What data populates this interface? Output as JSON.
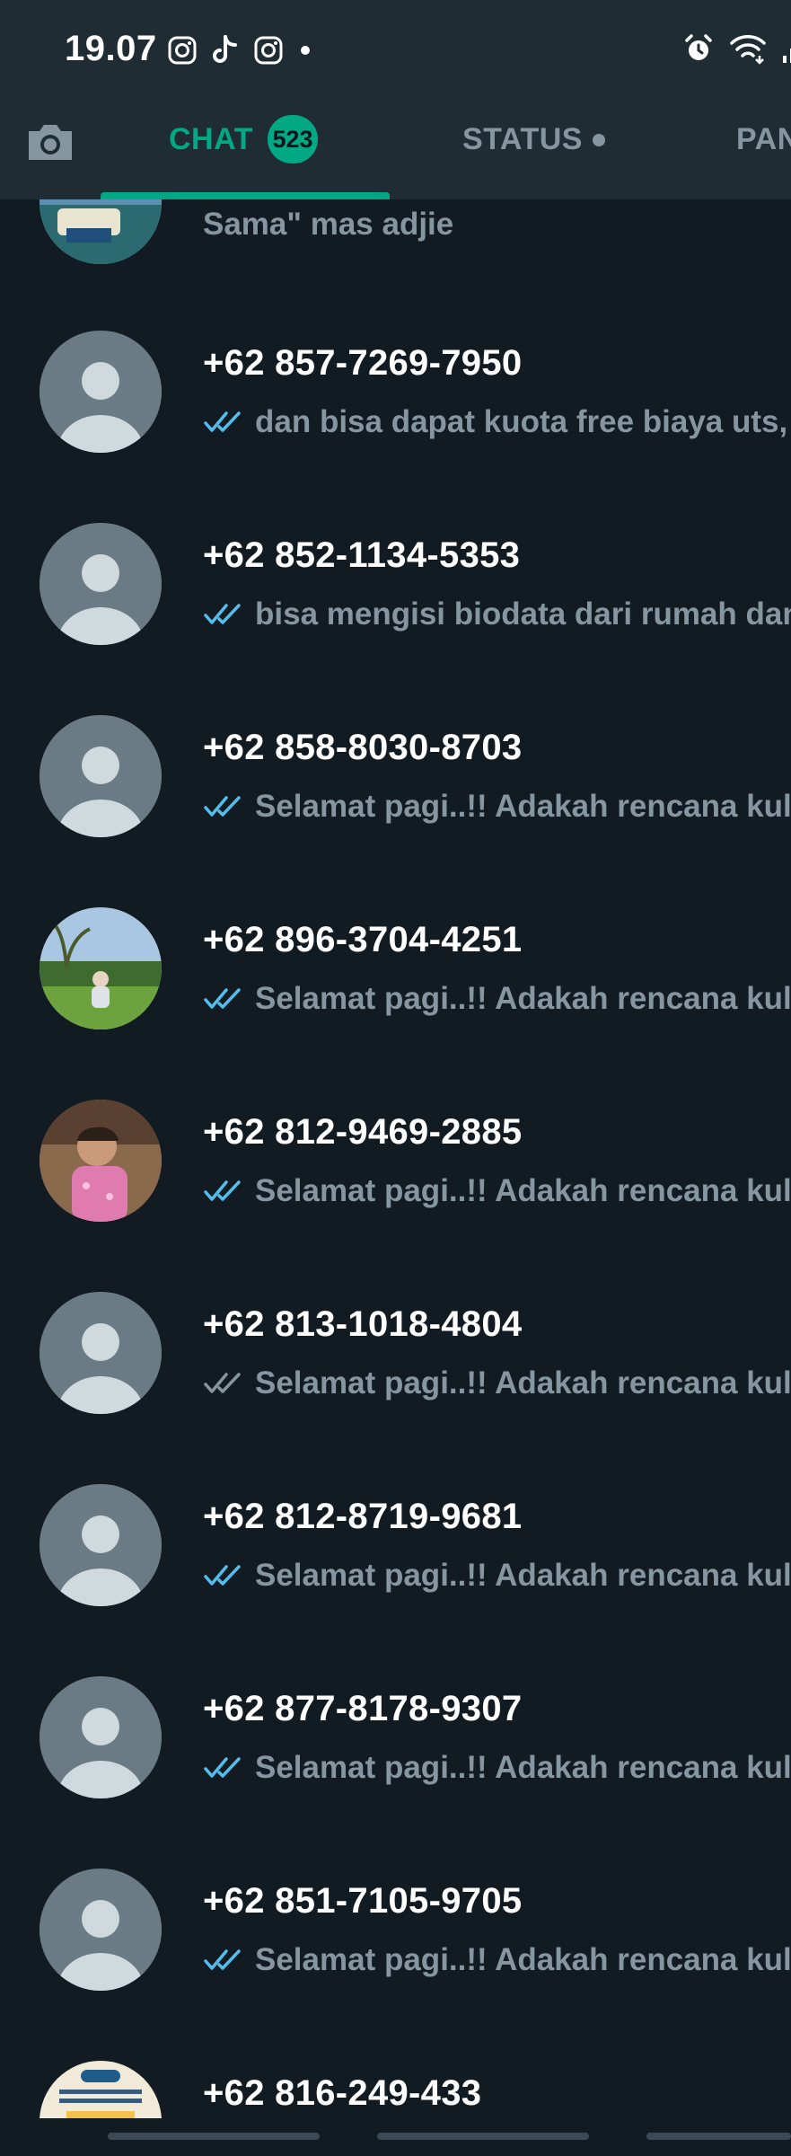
{
  "statusbar": {
    "time": "19.07",
    "left_icons": [
      "instagram-icon",
      "tiktok-icon",
      "instagram-icon",
      "notification-dot-icon"
    ],
    "right_icons": [
      "alarm-icon",
      "wifi-icon",
      "signal-icon"
    ]
  },
  "tabs": {
    "camera_icon": "camera-icon",
    "chat_label": "CHAT",
    "chat_badge": "523",
    "status_label": "STATUS",
    "calls_label": "PANGGILAN",
    "active": "CHAT"
  },
  "colors": {
    "accent": "#00a884",
    "background": "#121b22",
    "header": "#1f2c34",
    "read_tick": "#53bdeb",
    "delivered_tick": "#8696a0"
  },
  "partial_chat": {
    "preview": "Sama\" mas adjie"
  },
  "chats": [
    {
      "name": "+62 857-7269-7950",
      "preview": "dan bisa dapat kuota free biaya uts, uas",
      "tick": "read",
      "avatar": "default"
    },
    {
      "name": "+62 852-1134-5353",
      "preview": "bisa mengisi biodata dari rumah dan",
      "tick": "read",
      "avatar": "default"
    },
    {
      "name": "+62 858-8030-8703",
      "preview": "Selamat pagi..!! Adakah rencana kuliah",
      "tick": "read",
      "avatar": "default"
    },
    {
      "name": "+62 896-3704-4251",
      "preview": "Selamat pagi..!! Adakah rencana kuliah",
      "tick": "read",
      "avatar": "photo-park"
    },
    {
      "name": "+62 812-9469-2885",
      "preview": "Selamat pagi..!! Adakah rencana kuliah",
      "tick": "read",
      "avatar": "photo-child"
    },
    {
      "name": "+62 813-1018-4804",
      "preview": "Selamat pagi..!! Adakah rencana kuliah",
      "tick": "delivered",
      "avatar": "default"
    },
    {
      "name": "+62 812-8719-9681",
      "preview": "Selamat pagi..!! Adakah rencana kuliah",
      "tick": "read",
      "avatar": "default"
    },
    {
      "name": "+62 877-8178-9307",
      "preview": "Selamat pagi..!! Adakah rencana kuliah",
      "tick": "read",
      "avatar": "default"
    },
    {
      "name": "+62 851-7105-9705",
      "preview": "Selamat pagi..!! Adakah rencana kuliah",
      "tick": "read",
      "avatar": "default"
    },
    {
      "name": "+62 816-249-433",
      "preview": "",
      "tick": "",
      "avatar": "photo-poster"
    }
  ]
}
